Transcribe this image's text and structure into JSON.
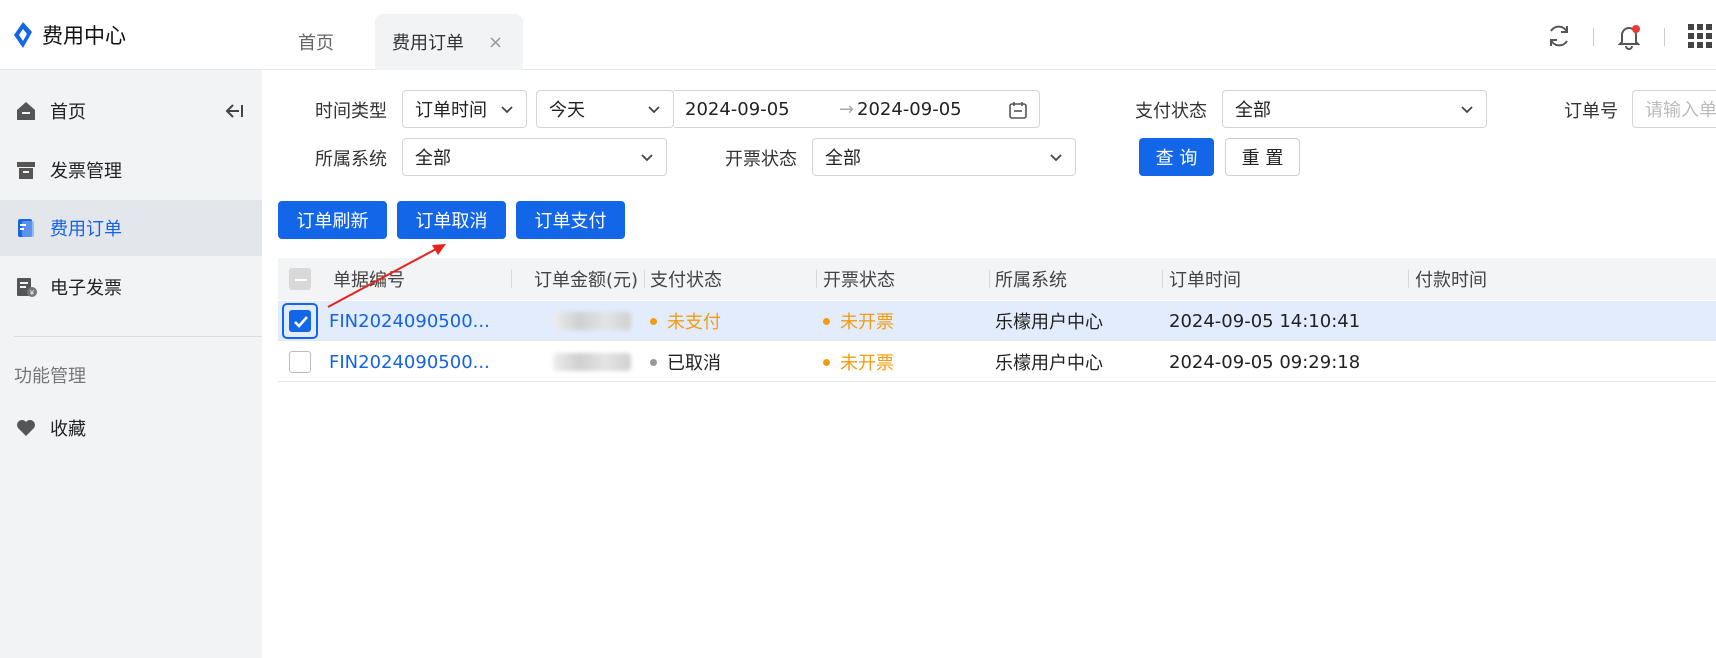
{
  "header": {
    "app_title": "费用中心",
    "tabs": [
      {
        "label": "首页"
      },
      {
        "label": "费用订单",
        "close": "×"
      }
    ],
    "icons": [
      "refresh-icon",
      "notification-bell-icon",
      "apps-grid-icon"
    ],
    "accent": "#1366e8",
    "badge_color": "#e53935"
  },
  "sidebar": {
    "items": [
      {
        "label": "首页",
        "icon": "home-icon"
      },
      {
        "label": "发票管理",
        "icon": "invoice-box-icon"
      },
      {
        "label": "费用订单",
        "icon": "order-doc-icon",
        "active": true
      },
      {
        "label": "电子发票",
        "icon": "e-invoice-icon"
      }
    ],
    "group_label": "功能管理",
    "group_items": [
      {
        "label": "收藏",
        "icon": "heart-icon"
      }
    ]
  },
  "filters": {
    "time_type_label": "时间类型",
    "time_type_value": "订单时间",
    "period_value": "今天",
    "date_start": "2024-09-05",
    "date_sep": "→",
    "date_end": "2024-09-05",
    "pay_status_label": "支付状态",
    "pay_status_value": "全部",
    "order_no_label": "订单号",
    "order_no_placeholder": "请输入单",
    "system_label": "所属系统",
    "system_value": "全部",
    "invoice_status_label": "开票状态",
    "invoice_status_value": "全部",
    "query_button": "查 询",
    "reset_button": "重 置"
  },
  "actions": {
    "refresh": "订单刷新",
    "cancel": "订单取消",
    "pay": "订单支付"
  },
  "table": {
    "columns": [
      "单据编号",
      "订单金额(元)",
      "支付状态",
      "开票状态",
      "所属系统",
      "订单时间",
      "付款时间"
    ],
    "rows": [
      {
        "id": "FIN2024090500...",
        "pay_status": "未支付",
        "invoice_status": "未开票",
        "system": "乐檬用户中心",
        "order_time": "2024-09-05 14:10:41",
        "paid_time": "",
        "selected": true
      },
      {
        "id": "FIN2024090500...",
        "pay_status": "已取消",
        "invoice_status": "未开票",
        "system": "乐檬用户中心",
        "order_time": "2024-09-05 09:29:18",
        "paid_time": "",
        "selected": false
      }
    ],
    "status_colors": {
      "unpaid": "#f39c12",
      "cancelled": "#999999",
      "uninvoiced": "#f39c12"
    }
  }
}
